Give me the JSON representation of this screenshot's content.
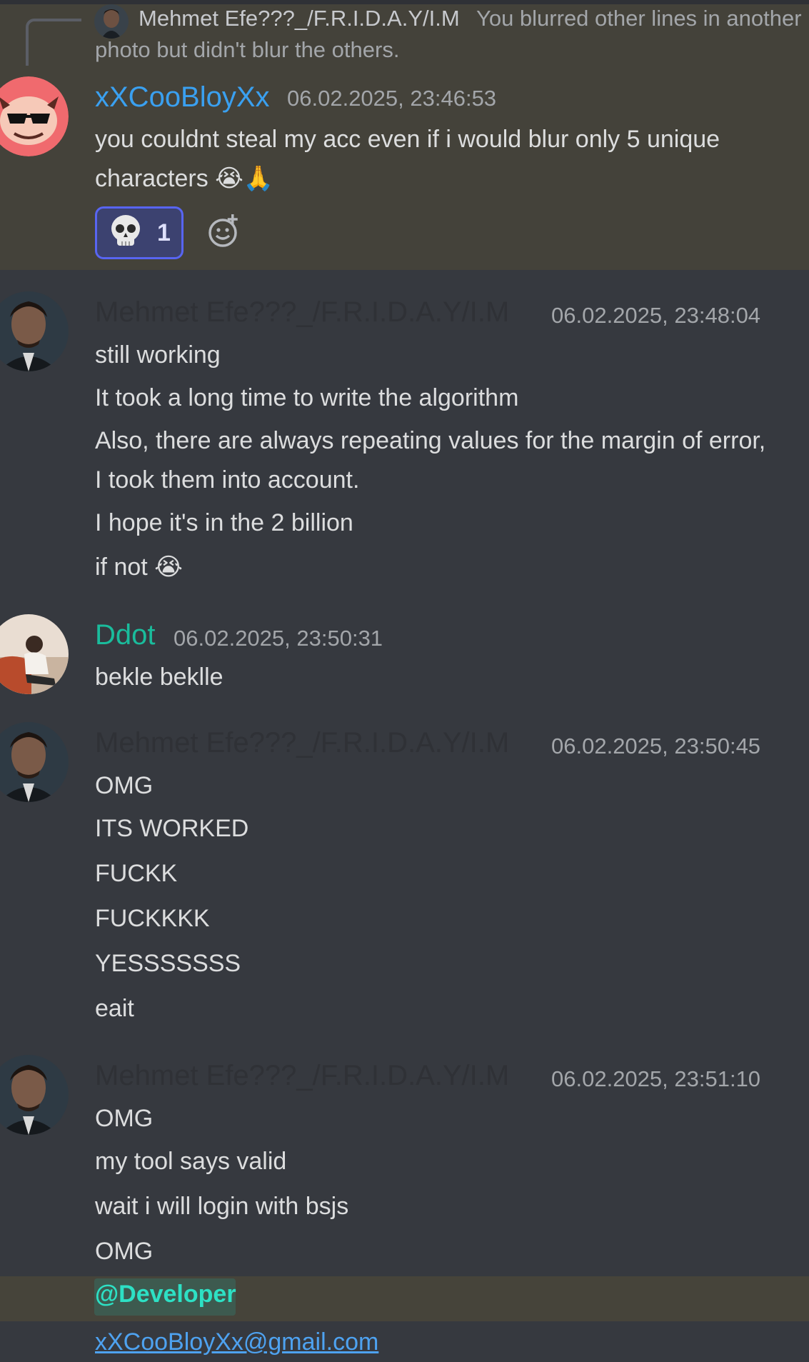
{
  "reply": {
    "author": "Mehmet Efe???_/F.R.I.D.A.Y/I.M",
    "text_line1": "You blurred other lines in another",
    "text_line2": "photo but didn't blur the others."
  },
  "messages": [
    {
      "author": "xXCooBloyXx",
      "author_color": "#3aa0f0",
      "timestamp": "06.02.2025, 23:46:53",
      "lines": [
        "you couldnt steal my acc even if i would blur only 5 unique",
        "characters 😭🙏"
      ],
      "reaction": {
        "emoji": "skull-emoji",
        "count": "1"
      }
    },
    {
      "author": "Mehmet Efe???_/F.R.I.D.A.Y/I.M",
      "author_color": "#2f3136",
      "timestamp": "06.02.2025, 23:48:04",
      "lines": [
        "still working",
        "It took a long time to write the algorithm",
        "Also, there are always repeating values for the margin of error,",
        "I took them into account.",
        "I hope it's in the 2 billion",
        "if not 😭"
      ]
    },
    {
      "author": "Ddot",
      "author_color": "#1abc9c",
      "timestamp": "06.02.2025, 23:50:31",
      "lines": [
        "bekle beklle"
      ]
    },
    {
      "author": "Mehmet Efe???_/F.R.I.D.A.Y/I.M",
      "author_color": "#2f3136",
      "timestamp": "06.02.2025, 23:50:45",
      "lines": [
        "OMG",
        "ITS WORKED",
        "FUCKK",
        "FUCKKKK",
        "YESSSSSSS",
        "eait"
      ]
    },
    {
      "author": "Mehmet Efe???_/F.R.I.D.A.Y/I.M",
      "author_color": "#2f3136",
      "timestamp": "06.02.2025, 23:51:10",
      "lines": [
        "OMG",
        "my tool says valid",
        "wait i will login with bsjs",
        "OMG"
      ],
      "mention": "@Developer",
      "email": "xXCooBloyXx@gmail.com"
    }
  ]
}
